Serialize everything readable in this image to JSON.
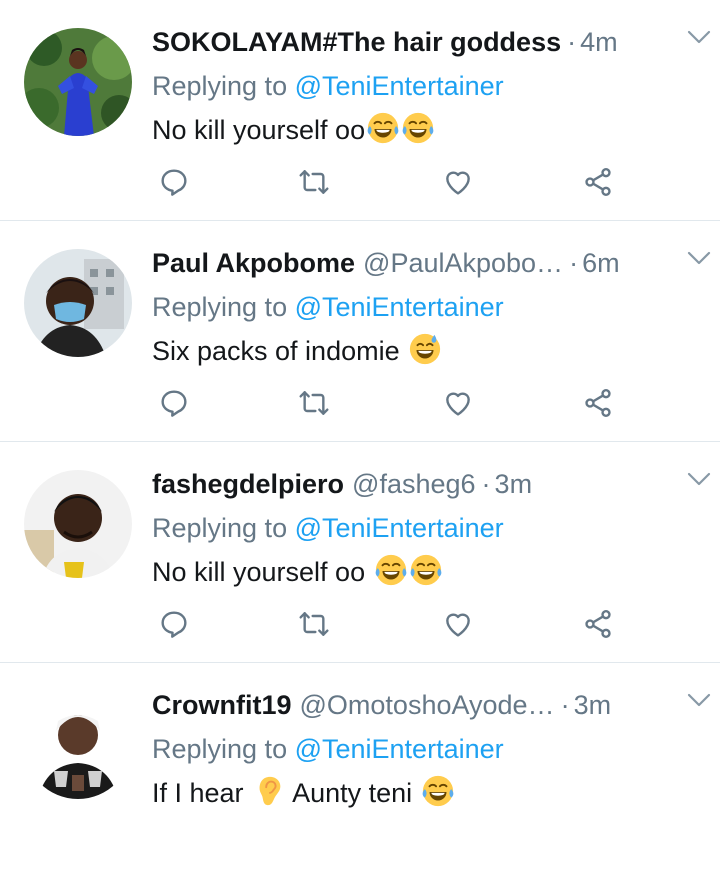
{
  "tweets": [
    {
      "name": "SOKOLAYAM#The hair goddess",
      "handle": "",
      "separator": "·",
      "time": "4m",
      "replying_prefix": "Replying to ",
      "replying_to": "@TeniEntertainer",
      "text": "No kill yourself oo",
      "emojis": [
        "tears-of-joy",
        "tears-of-joy"
      ]
    },
    {
      "name": "Paul Akpobome",
      "handle": "@PaulAkpobo…",
      "separator": "·",
      "time": "6m",
      "replying_prefix": "Replying to ",
      "replying_to": "@TeniEntertainer",
      "text": "Six packs of indomie ",
      "emojis": [
        "grinning-sweat"
      ]
    },
    {
      "name": "fashegdelpiero",
      "handle": "@fasheg6",
      "separator": "·",
      "time": "3m",
      "replying_prefix": "Replying to ",
      "replying_to": "@TeniEntertainer",
      "text": "No kill yourself oo ",
      "emojis": [
        "tears-of-joy",
        "tears-of-joy"
      ]
    },
    {
      "name": "Crownfit19",
      "handle": "@OmotoshoAyode…",
      "separator": "·",
      "time": "3m",
      "replying_prefix": "Replying to ",
      "replying_to": "@TeniEntertainer",
      "text_before": "If I hear ",
      "text_after": " Aunty teni ",
      "emojis": [
        "ear",
        "tears-of-joy"
      ]
    }
  ],
  "icons": {
    "reply": "reply-icon",
    "retweet": "retweet-icon",
    "like": "like-icon",
    "share": "share-icon",
    "more": "chevron-down-icon"
  },
  "colors": {
    "link": "#1da1f2",
    "muted": "#657786",
    "text": "#14171a",
    "divider": "#e1e8ed"
  }
}
